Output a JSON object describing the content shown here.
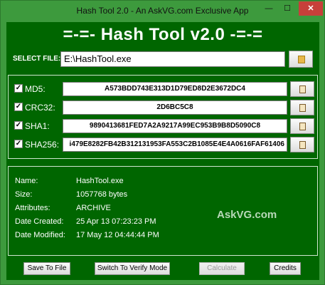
{
  "window": {
    "title": "Hash Tool 2.0 - An AskVG.com Exclusive App",
    "minimize": "—",
    "maximize": "☐",
    "close": "✕"
  },
  "heading": "=-=- Hash Tool v2.0 -=-=",
  "select_file": {
    "label": "SELECT FILE:",
    "value": "E:\\HashTool.exe"
  },
  "hashes": [
    {
      "label": "MD5:",
      "checked": "✓",
      "value": "A573BDD743E313D1D79ED8D2E3672DC4",
      "overflow": false
    },
    {
      "label": "CRC32:",
      "checked": "✓",
      "value": "2D6BC5C8",
      "overflow": false
    },
    {
      "label": "SHA1:",
      "checked": "✓",
      "value": "9890413681FED7A2A9217A99EC953B9B8D5090C8",
      "overflow": false
    },
    {
      "label": "SHA256:",
      "checked": "✓",
      "value": "i479E8282FB42B312131953FA553C2B1085E4E4A0616FAF61406",
      "overflow": true
    }
  ],
  "info": [
    {
      "key": "Name:",
      "value": "HashTool.exe"
    },
    {
      "key": "Size:",
      "value": "1057768 bytes"
    },
    {
      "key": "Attributes:",
      "value": "ARCHIVE"
    },
    {
      "key": "Date Created:",
      "value": "25 Apr 13 07:23:23 PM"
    },
    {
      "key": "Date Modified:",
      "value": "17 May 12 04:44:44 PM"
    }
  ],
  "watermark": "AskVG.com",
  "buttons": {
    "save": "Save To File",
    "verify": "Switch To Verify Mode",
    "calculate": "Calculate",
    "credits": "Credits"
  }
}
